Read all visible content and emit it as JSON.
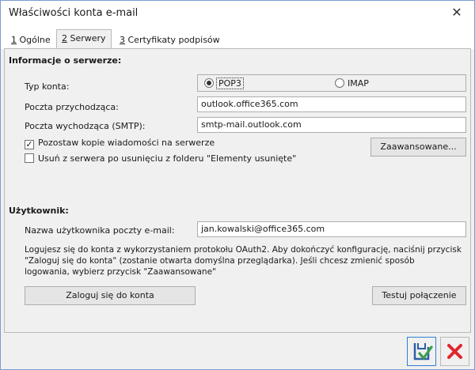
{
  "window": {
    "title": "Właściwości konta e-mail",
    "close_glyph": "✕"
  },
  "tabs": [
    {
      "key": "1",
      "label": " Ogólne",
      "active": false
    },
    {
      "key": "2",
      "label": " Serwery",
      "active": true
    },
    {
      "key": "3",
      "label": " Certyfikaty podpisów",
      "active": false
    }
  ],
  "server_section": {
    "title": "Informacje o serwerze:",
    "account_type_label": "Typ konta:",
    "options": [
      {
        "label": "POP3",
        "selected": true
      },
      {
        "label": "IMAP",
        "selected": false
      }
    ],
    "incoming_label": "Poczta przychodząca:",
    "incoming_value": "outlook.office365.com",
    "outgoing_label": "Poczta wychodząca (SMTP):",
    "outgoing_value": "smtp-mail.outlook.com",
    "keep_copy_label": "Pozostaw kopie wiadomości na serwerze",
    "keep_copy_checked": true,
    "delete_label": "Usuń z serwera po usunięciu z folderu \"Elementy usunięte\"",
    "delete_checked": false,
    "advanced_button": "Zaawansowane..."
  },
  "user_section": {
    "title": "Użytkownik:",
    "username_label": "Nazwa użytkownika poczty e-mail:",
    "username_value": "jan.kowalski@office365.com",
    "info_text": "Logujesz się do konta z wykorzystaniem protokołu OAuth2. Aby dokończyć konfigurację, naciśnij przycisk \"Zaloguj się do konta\" (zostanie otwarta domyślna przeglądarka). Jeśli chcesz zmienić sposób logowania, wybierz przycisk \"Zaawansowane\"",
    "login_button": "Zaloguj się do konta",
    "test_button": "Testuj połączenie"
  },
  "footer": {
    "save_icon": "save-check-icon",
    "cancel_icon": "cancel-x-icon"
  },
  "colors": {
    "accent": "#2f7fd6",
    "cancel": "#e0262b",
    "save_green": "#3aa04a"
  }
}
